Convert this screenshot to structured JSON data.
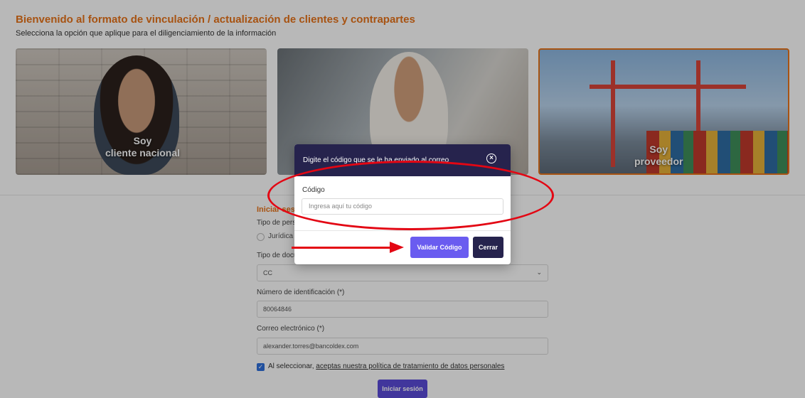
{
  "header": {
    "title": "Bienvenido al formato de vinculación / actualización de clientes y contrapartes",
    "subtitle": "Selecciona la opción que aplique para el diligenciamiento de la información"
  },
  "cards": [
    {
      "label_line1": "Soy",
      "label_line2": "cliente nacional"
    },
    {
      "label_line1": "",
      "label_line2": ""
    },
    {
      "label_line1": "Soy",
      "label_line2": "proveedor"
    }
  ],
  "form": {
    "heading": "Iniciar ses",
    "person_type_label": "Tipo de pers",
    "person_type_option": "Jurídica",
    "doc_type_label": "Tipo de docu",
    "doc_type_value": "CC",
    "id_label": "Número de identificación (*)",
    "id_value": "80064846",
    "email_label": "Correo electrónico (*)",
    "email_value": "alexander.torres@bancoldex.com",
    "consent_prefix": "Al seleccionar,",
    "consent_link": "aceptas nuestra política de tratamiento de datos personales",
    "submit_label": "Iniciar sesión"
  },
  "modal": {
    "title": "Digite el código que se le ha enviado al correo",
    "code_label": "Código",
    "code_placeholder": "Ingresa aquí tu código",
    "validate_label": "Validar Código",
    "close_label": "Cerrar"
  },
  "icons": {
    "close": "close-circle-icon",
    "chevron": "chevron-down-icon",
    "checkbox": "check-icon"
  },
  "colors": {
    "accent_orange": "#e8731a",
    "modal_header": "#26234d",
    "validate_button": "#6a5cf0",
    "annotation_red": "#e30613"
  }
}
